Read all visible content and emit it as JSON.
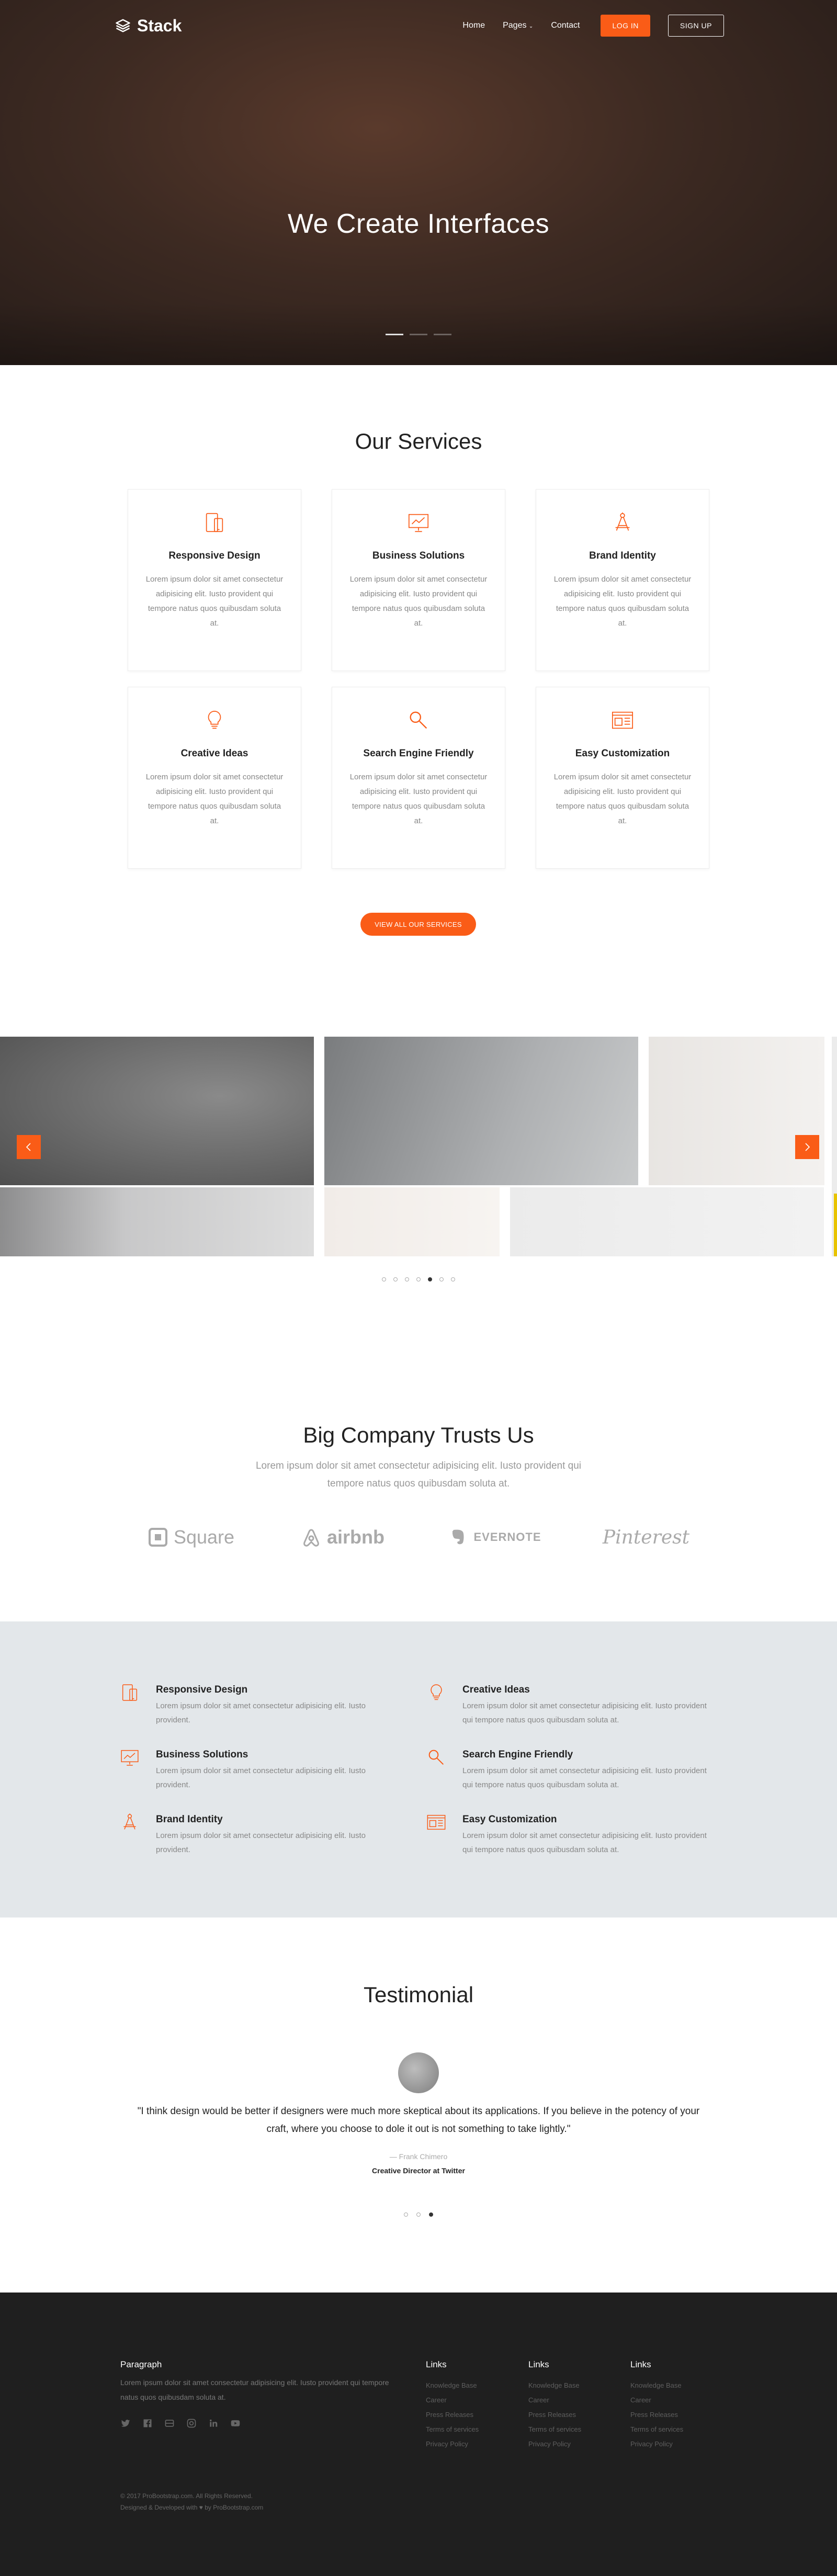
{
  "header": {
    "logo_text": "Stack",
    "menu": [
      "Home",
      "Pages",
      "Contact"
    ],
    "login_label": "LOG IN",
    "signup_label": "SIGN UP"
  },
  "hero": {
    "title": "We Create Interfaces",
    "slides": 3,
    "active_slide": 1
  },
  "services": {
    "title": "Our Services",
    "items": [
      {
        "icon": "tablet-icon",
        "title": "Responsive Design",
        "text": "Lorem ipsum dolor sit amet consectetur adipisicing elit. Iusto provident qui tempore natus quos quibusdam soluta at."
      },
      {
        "icon": "presentation-chart-icon",
        "title": "Business Solutions",
        "text": "Lorem ipsum dolor sit amet consectetur adipisicing elit. Iusto provident qui tempore natus quos quibusdam soluta at."
      },
      {
        "icon": "compass-icon",
        "title": "Brand Identity",
        "text": "Lorem ipsum dolor sit amet consectetur adipisicing elit. Iusto provident qui tempore natus quos quibusdam soluta at."
      },
      {
        "icon": "lightbulb-icon",
        "title": "Creative Ideas",
        "text": "Lorem ipsum dolor sit amet consectetur adipisicing elit. Iusto provident qui tempore natus quos quibusdam soluta at."
      },
      {
        "icon": "magnifier-icon",
        "title": "Search Engine Friendly",
        "text": "Lorem ipsum dolor sit amet consectetur adipisicing elit. Iusto provident qui tempore natus quos quibusdam soluta at."
      },
      {
        "icon": "browser-window-icon",
        "title": "Easy Customization",
        "text": "Lorem ipsum dolor sit amet consectetur adipisicing elit. Iusto provident qui tempore natus quos quibusdam soluta at."
      }
    ],
    "view_all_label": "VIEW ALL OUR SERVICES"
  },
  "gallery": {
    "dots": 7,
    "active_dot": 5
  },
  "trust": {
    "title": "Big Company Trusts Us",
    "text": "Lorem ipsum dolor sit amet consectetur adipisicing elit. Iusto provident qui tempore natus quos quibusdam soluta at.",
    "brands": [
      "Square",
      "airbnb",
      "EVERNOTE",
      "Pinterest"
    ]
  },
  "features": [
    {
      "icon": "tablet-icon",
      "title": "Responsive Design",
      "text": "Lorem ipsum dolor sit amet consectetur adipisicing elit. Iusto provident."
    },
    {
      "icon": "lightbulb-icon",
      "title": "Creative Ideas",
      "text": "Lorem ipsum dolor sit amet consectetur adipisicing elit. Iusto provident qui tempore natus quos quibusdam soluta at."
    },
    {
      "icon": "presentation-chart-icon",
      "title": "Business Solutions",
      "text": "Lorem ipsum dolor sit amet consectetur adipisicing elit. Iusto provident."
    },
    {
      "icon": "magnifier-icon",
      "title": "Search Engine Friendly",
      "text": "Lorem ipsum dolor sit amet consectetur adipisicing elit. Iusto provident qui tempore natus quos quibusdam soluta at."
    },
    {
      "icon": "compass-icon",
      "title": "Brand Identity",
      "text": "Lorem ipsum dolor sit amet consectetur adipisicing elit. Iusto provident."
    },
    {
      "icon": "browser-window-icon",
      "title": "Easy Customization",
      "text": "Lorem ipsum dolor sit amet consectetur adipisicing elit. Iusto provident qui tempore natus quos quibusdam soluta at."
    }
  ],
  "testimonial": {
    "title": "Testimonial",
    "quote": "\"I think design would be better if designers were much more skeptical about its applications. If you believe in the potency of your craft, where you choose to dole it out is not something to take lightly.\"",
    "author": "— Frank Chimero",
    "role": "Creative Director at Twitter",
    "dots": 3,
    "active_dot": 3
  },
  "footer": {
    "about_title": "Paragraph",
    "about_text": "Lorem ipsum dolor sit amet consectetur adipisicing elit. Iusto provident qui tempore natus quos quibusdam soluta at.",
    "socials": [
      "twitter-icon",
      "facebook-icon",
      "dribbble-icon",
      "instagram-icon",
      "linkedin-icon",
      "youtube-icon"
    ],
    "columns": [
      {
        "title": "Links",
        "items": [
          "Knowledge Base",
          "Career",
          "Press Releases",
          "Terms of services",
          "Privacy Policy"
        ]
      },
      {
        "title": "Links",
        "items": [
          "Knowledge Base",
          "Career",
          "Press Releases",
          "Terms of services",
          "Privacy Policy"
        ]
      },
      {
        "title": "Links",
        "items": [
          "Knowledge Base",
          "Career",
          "Press Releases",
          "Terms of services",
          "Privacy Policy"
        ]
      }
    ],
    "copyright": "© 2017 ProBootstrap.com. All Rights Reserved.",
    "designed_by": "Designed & Developed with ♥ by ProBootstrap.com"
  },
  "colors": {
    "accent": "#fa5c17",
    "features_bg": "#e3e7ea",
    "footer_bg": "#1f1f1f"
  }
}
